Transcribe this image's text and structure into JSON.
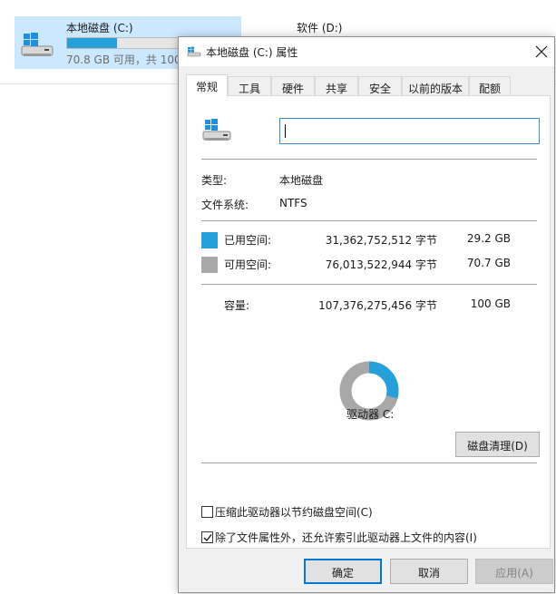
{
  "explorer": {
    "drive_c": {
      "name": "本地磁盘 (C:)",
      "subtitle": "70.8 GB 可用，共 100",
      "usage_fraction": 0.29
    },
    "drive_d": {
      "name": "软件 (D:)"
    }
  },
  "dialog": {
    "title": "本地磁盘 (C:) 属性",
    "tabs": [
      "常规",
      "工具",
      "硬件",
      "共享",
      "安全",
      "以前的版本",
      "配额"
    ],
    "active_tab": "常规",
    "name_value": "",
    "type_label": "类型:",
    "type_value": "本地磁盘",
    "fs_label": "文件系统:",
    "fs_value": "NTFS",
    "used": {
      "label": "已用空间:",
      "bytes": "31,362,752,512 字节",
      "size": "29.2 GB",
      "color": "#26a0da"
    },
    "free": {
      "label": "可用空间:",
      "bytes": "76,013,522,944 字节",
      "size": "70.7 GB",
      "color": "#a8a8a8"
    },
    "capacity": {
      "label": "容量:",
      "bytes": "107,376,275,456 字节",
      "size": "100 GB"
    },
    "used_fraction": 0.292,
    "drive_label": "驱动器 C:",
    "cleanup_button": "磁盘清理(D)",
    "compress_label": "压缩此驱动器以节约磁盘空间(C)",
    "compress_checked": false,
    "index_label": "除了文件属性外，还允许索引此驱动器上文件的内容(I)",
    "index_checked": true,
    "ok_button": "确定",
    "cancel_button": "取消",
    "apply_button": "应用(A)"
  },
  "icons": {
    "drive": "hard-drive-windows-icon",
    "close": "close-icon",
    "check": "checkmark-icon"
  },
  "colors": {
    "accent": "#0078d7",
    "selection": "#cce8ff",
    "used": "#26a0da",
    "free": "#a8a8a8"
  }
}
